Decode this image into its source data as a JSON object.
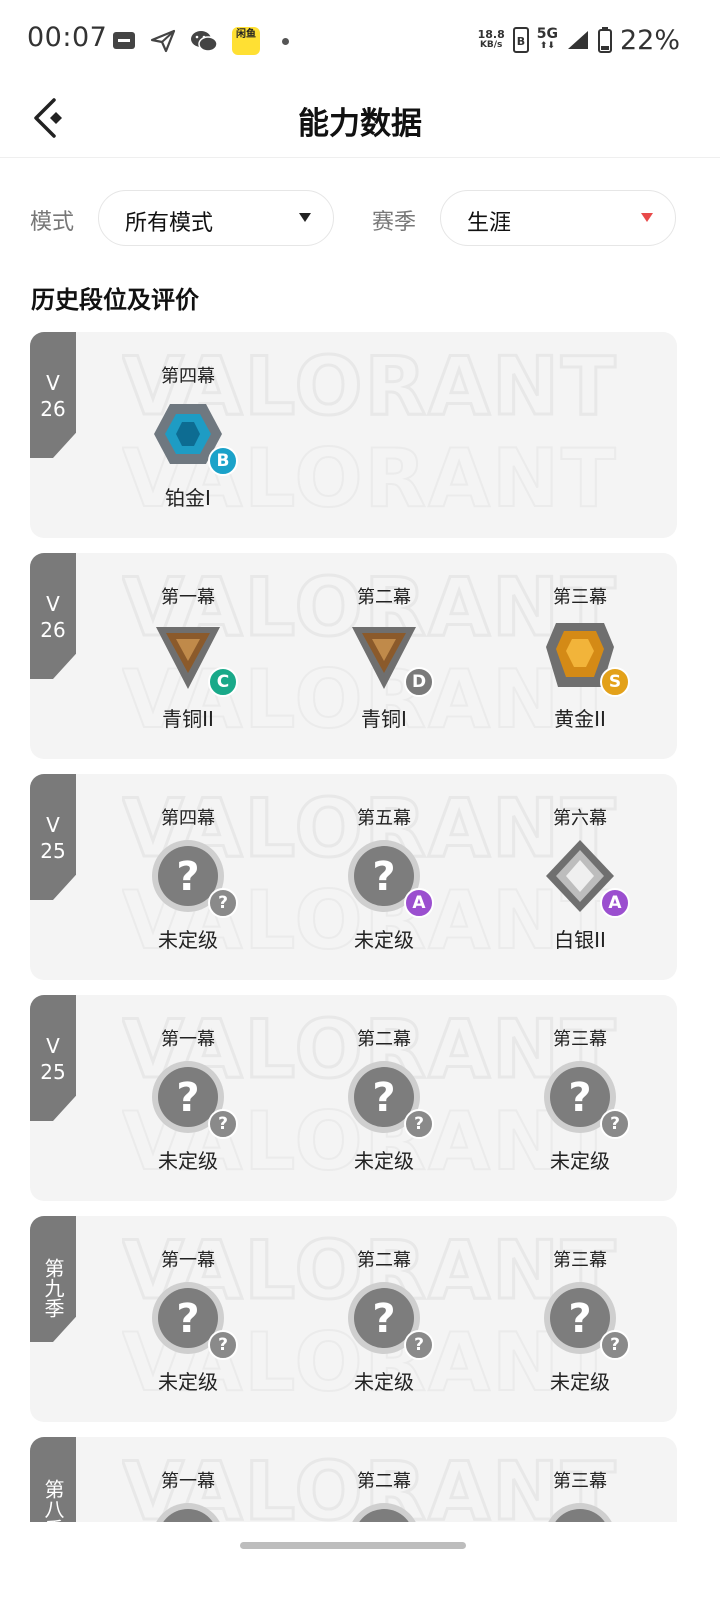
{
  "status_bar": {
    "time": "00:07",
    "app_badge": "闲鱼",
    "speed_value": "18.8",
    "speed_unit": "KB/s",
    "network": "5G",
    "battery": "22%"
  },
  "header": {
    "title": "能力数据",
    "back_icon": "back-arrow-icon"
  },
  "filters": {
    "mode_label": "模式",
    "mode_value": "所有模式",
    "season_label": "赛季",
    "season_value": "生涯"
  },
  "section_title": "历史段位及评价",
  "colors": {
    "season_tag": "#7a7a7a",
    "grade_B": "#1ba2c9",
    "grade_C": "#19a989",
    "grade_D": "#7a7a7a",
    "grade_S": "#e3a11a",
    "grade_A": "#9b4fcf",
    "grade_unknown": "#8a8a8a"
  },
  "cards": [
    {
      "season_line1": "V",
      "season_line2": "26",
      "acts": [
        {
          "name": "第四幕",
          "rank": "铂金I",
          "badge": "platinum",
          "grade": "B"
        }
      ]
    },
    {
      "season_line1": "V",
      "season_line2": "26",
      "acts": [
        {
          "name": "第一幕",
          "rank": "青铜II",
          "badge": "bronze",
          "grade": "C"
        },
        {
          "name": "第二幕",
          "rank": "青铜I",
          "badge": "bronze",
          "grade": "D"
        },
        {
          "name": "第三幕",
          "rank": "黄金II",
          "badge": "gold",
          "grade": "S"
        }
      ]
    },
    {
      "season_line1": "V",
      "season_line2": "25",
      "acts": [
        {
          "name": "第四幕",
          "rank": "未定级",
          "badge": "unranked",
          "grade": "?"
        },
        {
          "name": "第五幕",
          "rank": "未定级",
          "badge": "unranked",
          "grade": "A"
        },
        {
          "name": "第六幕",
          "rank": "白银II",
          "badge": "silver",
          "grade": "A"
        }
      ]
    },
    {
      "season_line1": "V",
      "season_line2": "25",
      "acts": [
        {
          "name": "第一幕",
          "rank": "未定级",
          "badge": "unranked",
          "grade": "?"
        },
        {
          "name": "第二幕",
          "rank": "未定级",
          "badge": "unranked",
          "grade": "?"
        },
        {
          "name": "第三幕",
          "rank": "未定级",
          "badge": "unranked",
          "grade": "?"
        }
      ]
    },
    {
      "season_text": "第九季",
      "acts": [
        {
          "name": "第一幕",
          "rank": "未定级",
          "badge": "unranked",
          "grade": "?"
        },
        {
          "name": "第二幕",
          "rank": "未定级",
          "badge": "unranked",
          "grade": "?"
        },
        {
          "name": "第三幕",
          "rank": "未定级",
          "badge": "unranked",
          "grade": "?"
        }
      ]
    },
    {
      "season_text": "第八季",
      "acts": [
        {
          "name": "第一幕",
          "rank": "",
          "badge": "unranked",
          "grade": ""
        },
        {
          "name": "第二幕",
          "rank": "",
          "badge": "unranked",
          "grade": ""
        },
        {
          "name": "第三幕",
          "rank": "",
          "badge": "unranked",
          "grade": ""
        }
      ]
    }
  ]
}
